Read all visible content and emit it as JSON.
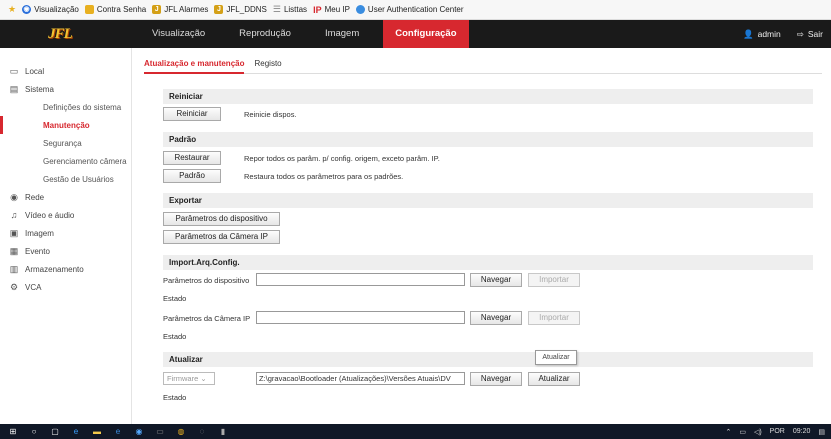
{
  "bookmarks": [
    {
      "label": "Visualização",
      "icon": "globe-icon",
      "color": "#2a6fdb"
    },
    {
      "label": "Contra Senha",
      "icon": "page-icon",
      "color": "#e8b020"
    },
    {
      "label": "JFL Alarmes",
      "icon": "jfl-icon",
      "color": "#d4a017"
    },
    {
      "label": "JFL_DDNS",
      "icon": "jfl-icon",
      "color": "#d4a017"
    },
    {
      "label": "Listtas",
      "icon": "list-icon",
      "color": "#888888"
    },
    {
      "label": "Meu IP",
      "icon": "ip-icon",
      "color": "#d7282f"
    },
    {
      "label": "User Authentication Center",
      "icon": "users-icon",
      "color": "#3a8de0"
    }
  ],
  "header": {
    "logo": "JFL",
    "nav": [
      "Visualização",
      "Reprodução",
      "Imagem",
      "Configuração"
    ],
    "active_nav": "Configuração",
    "user": "admin",
    "logout": "Sair"
  },
  "sidebar": {
    "items": [
      {
        "label": "Local",
        "type": "group",
        "icon": "monitor-icon"
      },
      {
        "label": "Sistema",
        "type": "group",
        "icon": "system-icon"
      },
      {
        "label": "Definições do sistema",
        "type": "sub"
      },
      {
        "label": "Manutenção",
        "type": "sub",
        "active": true
      },
      {
        "label": "Segurança",
        "type": "sub"
      },
      {
        "label": "Gerenciamento câmera",
        "type": "sub"
      },
      {
        "label": "Gestão de Usuários",
        "type": "sub"
      },
      {
        "label": "Rede",
        "type": "group",
        "icon": "network-icon"
      },
      {
        "label": "Vídeo e áudio",
        "type": "group",
        "icon": "video-audio-icon"
      },
      {
        "label": "Imagem",
        "type": "group",
        "icon": "image-icon"
      },
      {
        "label": "Evento",
        "type": "group",
        "icon": "event-icon"
      },
      {
        "label": "Armazenamento",
        "type": "group",
        "icon": "storage-icon"
      },
      {
        "label": "VCA",
        "type": "group",
        "icon": "vca-icon"
      }
    ]
  },
  "tabs": {
    "maintenance": "Atualização e manutenção",
    "log": "Registo"
  },
  "reboot": {
    "section": "Reiniciar",
    "button": "Reiniciar",
    "desc": "Reinicie dispos."
  },
  "default": {
    "section": "Padrão",
    "restore_button": "Restaurar",
    "restore_desc": "Repor todos os parâm. p/ config. origem, exceto parâm. IP.",
    "default_button": "Padrão",
    "default_desc": "Restaura todos os parâmetros para os padrões."
  },
  "export": {
    "section": "Exportar",
    "device_params": "Parâmetros do dispositivo",
    "ipcam_params": "Parâmetros da Câmera IP"
  },
  "import": {
    "section": "Import.Arq.Config.",
    "device_label": "Parâmetros do dispositivo",
    "device_value": "",
    "browse": "Navegar",
    "import": "Importar",
    "status": "Estado",
    "ipcam_label": "Parâmetros da Câmera IP",
    "ipcam_value": "",
    "status2": "Estado"
  },
  "upgrade": {
    "section": "Atualizar",
    "tooltip": "Atualizar",
    "select": "Firmware",
    "path": "Z:\\gravacao\\Bootloader (Atualizações)\\Versões Atuais\\DV",
    "browse": "Navegar",
    "button": "Atualizar",
    "status": "Estado"
  },
  "tray": {
    "lang": "POR",
    "time": "09:20"
  }
}
